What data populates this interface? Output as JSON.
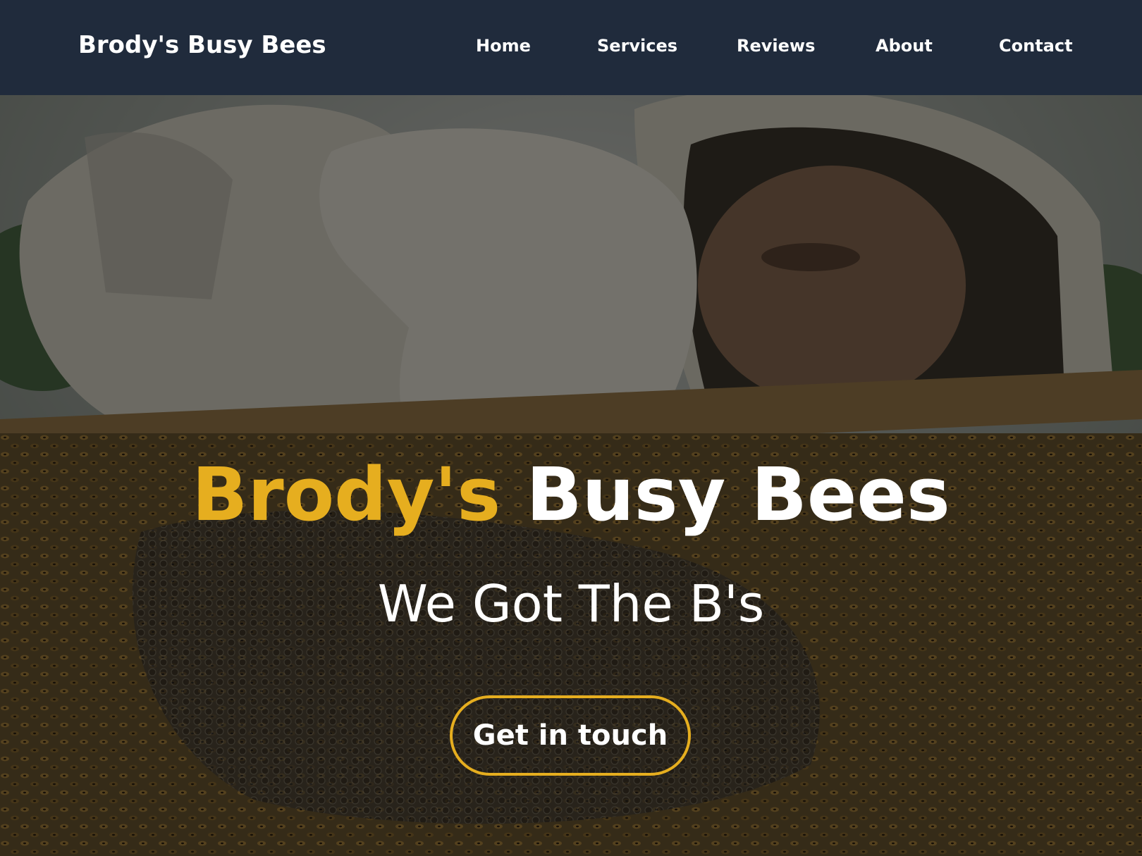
{
  "nav": {
    "brand": "Brody's Busy Bees",
    "links": [
      {
        "label": "Home"
      },
      {
        "label": "Services"
      },
      {
        "label": "Reviews"
      },
      {
        "label": "About"
      },
      {
        "label": "Contact"
      }
    ]
  },
  "hero": {
    "title_accent": "Brody's",
    "title_main": "Busy Bees",
    "subtitle": "We Got The B's",
    "cta_label": "Get in touch",
    "image_subject": "beekeeper-holding-honeycomb-frame-photo"
  },
  "colors": {
    "navbar": "#202b3c",
    "accent": "#e6ae1f",
    "text": "#ffffff"
  }
}
